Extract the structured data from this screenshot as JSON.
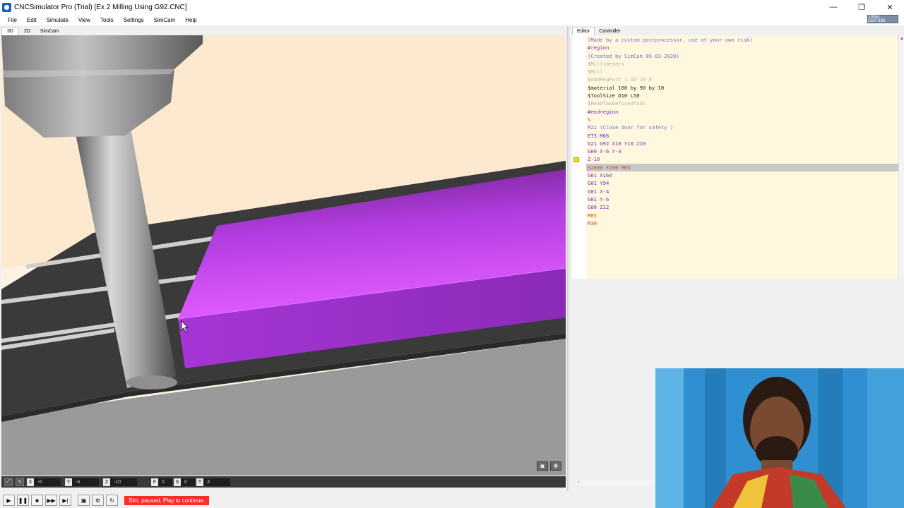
{
  "window": {
    "title": "CNCSimulator Pro (Trial) [Ex 2  Milling Using G92.CNC]",
    "minimize": "—",
    "restore": "❐",
    "close": "✕"
  },
  "menu": [
    "File",
    "Edit",
    "Simulate",
    "View",
    "Tools",
    "Settings",
    "SimCam",
    "Help"
  ],
  "badge": "TRIAL EDITION",
  "view_tabs": [
    "3D",
    "2D",
    "SimCam"
  ],
  "editor_tabs": [
    "Editor",
    "Controller"
  ],
  "code_lines": [
    {
      "text": "(Made by a custom postprocessor, use at your own risk)",
      "cls": "c-comment"
    },
    {
      "text": "#region",
      "cls": "c-region"
    },
    {
      "text": "(Created by SimCam 09-03-2020)",
      "cls": "c-comment"
    },
    {
      "text": "$Millimeters",
      "cls": "c-dim"
    },
    {
      "text": "$Mill",
      "cls": "c-dim"
    },
    {
      "text": "$AddRegPart 1 10 10 0",
      "cls": "c-dim"
    },
    {
      "text": "$material 160 by 90 by 10",
      "cls": "c-dark"
    },
    {
      "text": "$ToolSize D10 L50",
      "cls": "c-dark"
    },
    {
      "text": "$ReadTaxDefinedTool",
      "cls": "c-dim"
    },
    {
      "text": "#endregion",
      "cls": "c-region"
    },
    {
      "text": "%",
      "cls": "c-m"
    },
    {
      "text": "M21 (Close door for safety )",
      "cls": "c-comment"
    },
    {
      "text": "ET3 M06",
      "cls": "c-g"
    },
    {
      "text": "G21 G92 X10 Y10 Z10",
      "cls": "c-g"
    },
    {
      "text": "G00 X-6 Y-4",
      "cls": "c-g"
    },
    {
      "text": "Z-10",
      "cls": "c-g"
    },
    {
      "text": "S2000 F200 M03",
      "cls": "c-red"
    },
    {
      "text": "G01 X164",
      "cls": "c-g"
    },
    {
      "text": "G01 Y94",
      "cls": "c-g"
    },
    {
      "text": "G01 X-4",
      "cls": "c-g"
    },
    {
      "text": "G01 Y-6",
      "cls": "c-g"
    },
    {
      "text": "G00 Z12",
      "cls": "c-g"
    },
    {
      "text": "M05",
      "cls": "c-m"
    },
    {
      "text": "M30",
      "cls": "c-m"
    }
  ],
  "highlighted_line": 16,
  "marker_line": 15,
  "coords": [
    {
      "label": "X",
      "value": "-6"
    },
    {
      "label": "Y",
      "value": "-4"
    },
    {
      "label": "Z",
      "value": "-10"
    },
    {
      "label": "F",
      "value": "0"
    },
    {
      "label": "S",
      "value": "0"
    },
    {
      "label": "T",
      "value": "3"
    }
  ],
  "status_message": "Sim. paused, Play to continue.",
  "colors": {
    "workpiece_top": "#d548f5",
    "workpiece_front": "#9a2fc4",
    "table": "#3a3a3a",
    "background_warm": "#fdebd2",
    "status_red": "#ff2a2a"
  }
}
